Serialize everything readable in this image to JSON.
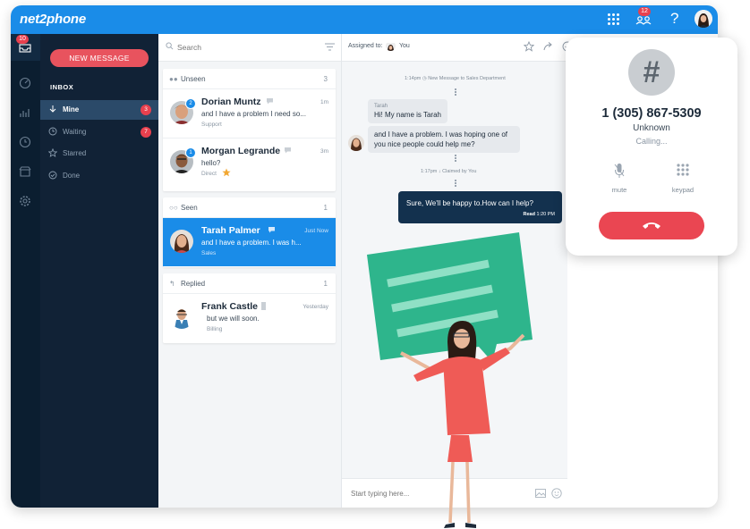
{
  "app": {
    "logo": "net2phone",
    "notification_count": "12",
    "help": "?"
  },
  "rail": {
    "inbox_badge": "10"
  },
  "nav": {
    "new_message": "NEW MESSAGE",
    "inbox_heading": "INBOX",
    "items": [
      {
        "label": "Mine",
        "count": "3",
        "icon": "arrow-down-icon"
      },
      {
        "label": "Waiting",
        "count": "7",
        "icon": "clock-icon"
      },
      {
        "label": "Starred",
        "count": "",
        "icon": "star-icon"
      },
      {
        "label": "Done",
        "count": "",
        "icon": "check-circle-icon"
      }
    ]
  },
  "list": {
    "search_placeholder": "Search",
    "sections": [
      {
        "label": "Unseen",
        "count": "3"
      },
      {
        "label": "Seen",
        "count": "1"
      },
      {
        "label": "Replied",
        "count": "1"
      }
    ],
    "conversations": [
      {
        "name": "Dorian Muntz",
        "message": "and I have a problem I need so...",
        "dept": "Support",
        "time": "1m",
        "badge": "2"
      },
      {
        "name": "Morgan Legrande",
        "message": "hello?",
        "dept": "Direct",
        "time": "3m",
        "badge": "1"
      },
      {
        "name": "Tarah Palmer",
        "message": "and I have a problem. I was h...",
        "dept": "Sales",
        "time": "Just Now",
        "badge": ""
      },
      {
        "name": "Frank Castle",
        "message": "but we will soon.",
        "dept": "Billing",
        "time": "Yesterday",
        "badge": ""
      }
    ]
  },
  "chat": {
    "assigned_label": "Assigned to:",
    "assigned_name": "You",
    "system_1_time": "1:14pm",
    "system_1_text": "New Message to Sales Department",
    "sender": "Tarah",
    "incoming_1": "Hi! My name is Tarah",
    "incoming_2": "and I have a problem. I was hoping one of you nice people could help me?",
    "system_2_time": "1:17pm",
    "system_2_text": "Claimed by You",
    "outgoing": "Sure, We'll be happy to.How can I help?",
    "read_label": "Read",
    "read_time": "1:20 PM",
    "compose_placeholder": "Start typing here..."
  },
  "call": {
    "avatar_symbol": "#",
    "number": "1 (305) 867-5309",
    "name": "Unknown",
    "status": "Calling...",
    "mute_label": "mute",
    "keypad_label": "keypad"
  },
  "colors": {
    "brand_blue": "#1a8ce8",
    "nav_dark": "#112236",
    "accent_red": "#e8535e",
    "illus_green": "#2eb58c",
    "illus_red": "#ef5b56"
  }
}
